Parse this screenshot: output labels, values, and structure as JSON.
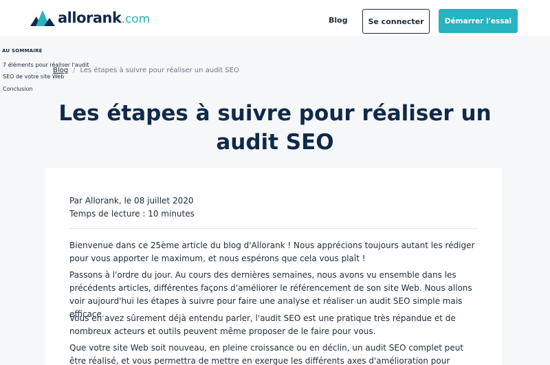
{
  "header": {
    "logo_text": "allorank",
    "logo_domain": ".com",
    "nav_blog": "Blog",
    "login_label": "Se connecter",
    "trial_label": "Démarrer l'essai"
  },
  "toc": {
    "title": "AU SOMMAIRE",
    "items": [
      "7 éléments pour réaliser l'audit",
      "SEO de votre site Web",
      "Conclusion"
    ]
  },
  "breadcrumb": {
    "link": "Blog",
    "separator": "/",
    "current": "Les étapes à suivre pour réaliser un audit SEO"
  },
  "article": {
    "title": "Les étapes à suivre pour réaliser un audit SEO",
    "author_line": "Par Allorank, le 08 juillet 2020",
    "reading_time": "Temps de lecture : 10 minutes",
    "paragraphs": [
      "Bienvenue dans ce 25ème article du blog d'Allorank ! Nous apprécions toujours autant les rédiger pour vous apporter le maximum, et nous espérons que cela vous plaît !",
      "Passons à l'ordre du jour. Au cours des dernières semaines, nous avons vu ensemble dans les précédents articles, différentes façons d'améliorer le référencement de son site Web. Nous allons voir aujourd'hui les étapes à suivre pour faire une analyse et réaliser un audit SEO simple mais efficace.",
      "Vous en avez sûrement déjà entendu parler, l'audit SEO est une pratique très répandue et de nombreux acteurs et outils peuvent même proposer de le faire pour vous.",
      "Que votre site Web soit nouveau, en pleine croissance ou en déclin, un audit SEO complet peut être réalisé, et vous permettra de mettre en exergue les différents axes d'amélioration pour optimiser votre"
    ]
  },
  "colors": {
    "brand_navy": "#0f2a4a",
    "brand_teal": "#27b3bf"
  }
}
